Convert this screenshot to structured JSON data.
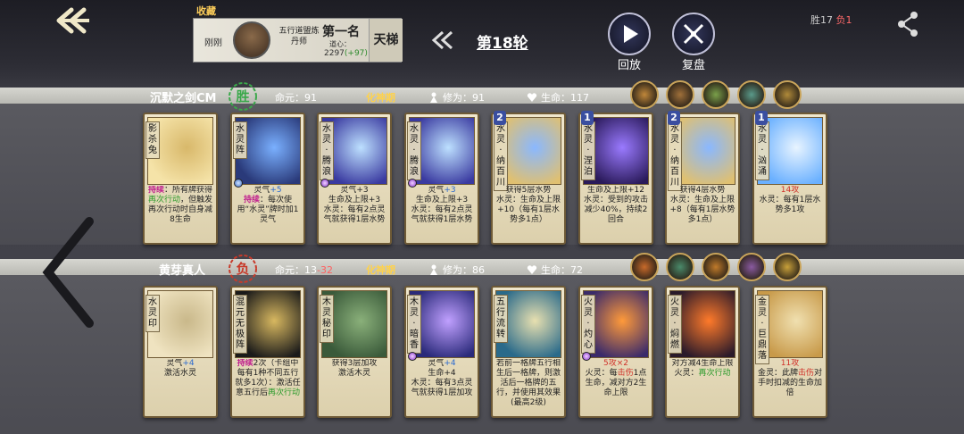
{
  "header": {
    "favorite_title": "收藏",
    "fav_time": "刚刚",
    "fav_clan": "五行道盟炼丹师",
    "fav_rank": "第一名",
    "fav_points_label": "道心：",
    "fav_points": "2297",
    "fav_points_delta": "(+97)",
    "fav_ladder": "天梯",
    "round": "第18轮",
    "replay_label": "回放",
    "review_label": "复盘",
    "record_win_label": "胜17",
    "record_loss_label": "负1"
  },
  "players": [
    {
      "name": "沉默之剑CM",
      "result": "胜",
      "result_color": "#3aa84a",
      "life_label": "命元：",
      "life": "91",
      "life_delta": "",
      "realm": "化神期",
      "cultivation": "修为：91",
      "hp": "生命：117",
      "skills": [
        "#c0873a",
        "#a0703a",
        "#7aa04a",
        "#5a9a8a",
        "#b08a3a"
      ],
      "cards": [
        {
          "name": "影杀兔",
          "level": "",
          "art": [
            "#f5e3a8",
            "#d8b86a"
          ],
          "gem": "",
          "desc_html": "<span class='kw'>持续</span>：所有牌获得<span class='gn'>再次行动</span>，但触发再次行动时自身减8生命"
        },
        {
          "name": "水灵阵",
          "level": "",
          "art": [
            "#2a3a7a",
            "#7ab0ff"
          ],
          "gem": "blue",
          "desc_html": "灵气<span class='bl'>+5</span><br><span class='kw'>持续</span>：每次使用“水灵”牌时加1灵气"
        },
        {
          "name": "水灵·腾浪",
          "level": "",
          "art": [
            "#3a3aa0",
            "#bde0ff"
          ],
          "gem": "purple",
          "desc_html": "灵气+3<br>生命及上限+3<br>水灵：每有2点灵气就获得1层水势"
        },
        {
          "name": "水灵·腾浪",
          "level": "",
          "art": [
            "#3a3aa0",
            "#bde0ff"
          ],
          "gem": "purple",
          "desc_html": "灵气<span class='bl'>+3</span><br>生命及上限+3<br>水灵：每有2点灵气就获得1层水势"
        },
        {
          "name": "水灵·纳百川",
          "level": "2",
          "art": [
            "#e0c070",
            "#8ab8ff"
          ],
          "gem": "",
          "desc_html": "获得5层水势<br>水灵：生命及上限+10（每有1层水势多1点）"
        },
        {
          "name": "水灵·涅泊",
          "level": "1",
          "art": [
            "#2a1a5a",
            "#9a7aff"
          ],
          "gem": "",
          "desc_html": "生命及上限+12<br>水灵：受到的攻击减少40%，持续2回合"
        },
        {
          "name": "水灵·纳百川",
          "level": "2",
          "art": [
            "#e0c070",
            "#8ab8ff"
          ],
          "gem": "",
          "desc_html": "获得4层水势<br>水灵：生命及上限+8（每有1层水势多1点）"
        },
        {
          "name": "水灵·汹涌",
          "level": "1",
          "art": [
            "#6ab0ff",
            "#e8f4ff"
          ],
          "gem": "",
          "desc_html": "<span class='rd'>14攻</span><br>水灵：每有1层水势多1攻"
        }
      ]
    },
    {
      "name": "黄芽真人",
      "result": "负",
      "result_color": "#c83a2a",
      "life_label": "命元：",
      "life": "13",
      "life_delta": "-32",
      "realm": "化神期",
      "cultivation": "修为：86",
      "hp": "生命：72",
      "skills": [
        "#c86a2a",
        "#4a8a6a",
        "#c07a2a",
        "#8a5aa0",
        "#c8a03a"
      ],
      "cards": [
        {
          "name": "水灵印",
          "level": "",
          "art": [
            "#efe3c0",
            "#c9b88a"
          ],
          "gem": "",
          "desc_html": "灵气<span class='bl'>+4</span><br>激活水灵"
        },
        {
          "name": "混元无极阵",
          "level": "",
          "art": [
            "#1a1a1a",
            "#d8b860"
          ],
          "gem": "",
          "desc_html": "<span class='kw'>持续</span>2次（卡组中每有1种不同五行就多1次）：激活任意五行后<span class='gn'>再次行动</span>"
        },
        {
          "name": "木灵秘印",
          "level": "",
          "art": [
            "#3a5a3a",
            "#8ab07a"
          ],
          "gem": "",
          "desc_html": "获得3层加攻<br>激活木灵"
        },
        {
          "name": "木灵·暗香",
          "level": "",
          "art": [
            "#2a2a7a",
            "#c0a0ff"
          ],
          "gem": "purple",
          "desc_html": "灵气<span class='bl'>+4</span><br>生命+4<br>木灵：每有3点灵气就获得1层加攻"
        },
        {
          "name": "五行流转",
          "level": "",
          "art": [
            "#2a6a8a",
            "#e8e0b0"
          ],
          "gem": "",
          "desc_html": "若前一格牌五行相生后一格牌，则激活后一格牌的五行，并使用其效果(最高2级)"
        },
        {
          "name": "火灵·灼心",
          "level": "",
          "art": [
            "#3a2a6a",
            "#ff9a3a"
          ],
          "gem": "purple",
          "desc_html": "<span class='rd'>5攻×2</span><br>火灵：每<span class='rd'>击伤</span>1点生命，减对方2生命上限"
        },
        {
          "name": "火灵·焖燃",
          "level": "",
          "art": [
            "#2a1a2a",
            "#ff7a2a"
          ],
          "gem": "",
          "desc_html": "对方减4生命上限<br>火灵：<span class='gn'>再次行动</span>"
        },
        {
          "name": "金灵·巨鼎落",
          "level": "",
          "art": [
            "#c89a4a",
            "#f0e0b0"
          ],
          "gem": "",
          "desc_html": "<span class='rd'>11攻</span><br>金灵：此牌<span class='rd'>击伤</span>对手时扣减的生命加倍"
        }
      ]
    }
  ]
}
